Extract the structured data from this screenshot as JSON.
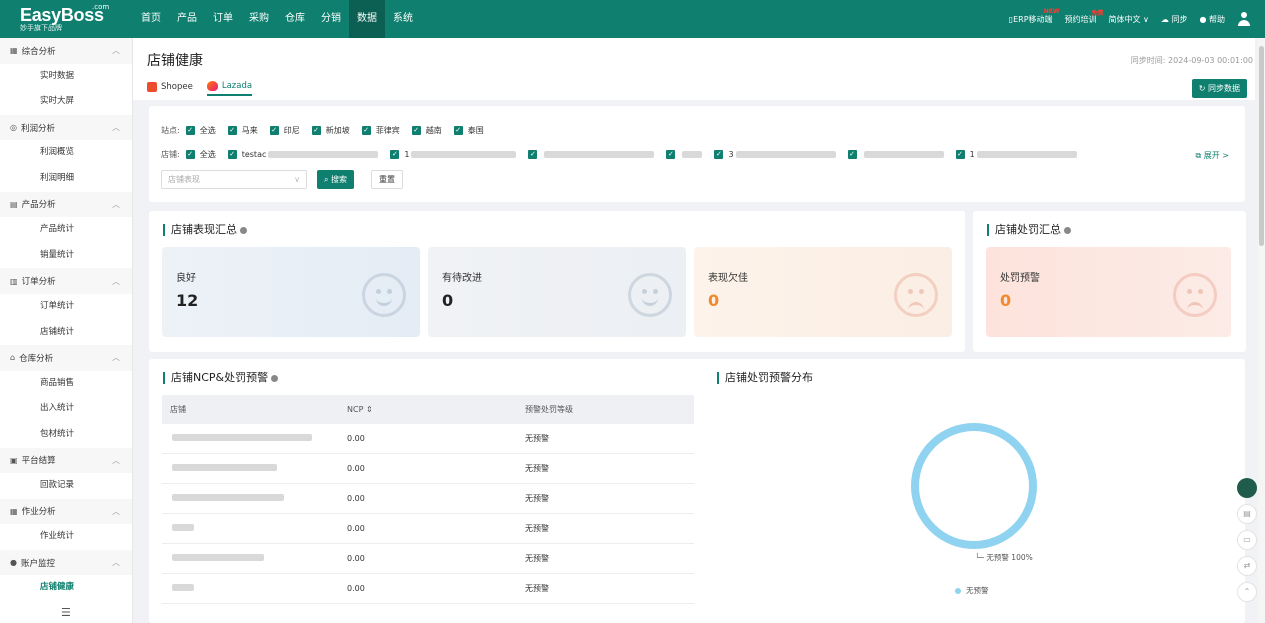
{
  "brand": {
    "name": "EasyBoss",
    "com": ".com",
    "tagline": "妙手旗下品牌"
  },
  "nav": [
    "首页",
    "产品",
    "订单",
    "采购",
    "仓库",
    "分销",
    "数据",
    "系统"
  ],
  "nav_active": "数据",
  "top_right": {
    "erp": "ERP移动端",
    "erp_badge": "NEW",
    "training": "预约培训",
    "training_badge": "免费",
    "lang": "简体中文 ∨",
    "sync": "同步",
    "help": "帮助"
  },
  "sidebar": [
    {
      "group": "综合分析",
      "items": [
        "实时数据",
        "实时大屏"
      ]
    },
    {
      "group": "利润分析",
      "items": [
        "利润概览",
        "利润明细"
      ]
    },
    {
      "group": "产品分析",
      "items": [
        "产品统计",
        "销量统计"
      ]
    },
    {
      "group": "订单分析",
      "items": [
        "订单统计",
        "店铺统计"
      ]
    },
    {
      "group": "仓库分析",
      "items": [
        "商品销售",
        "出入统计",
        "包材统计"
      ]
    },
    {
      "group": "平台结算",
      "items": [
        "回款记录"
      ]
    },
    {
      "group": "作业分析",
      "items": [
        "作业统计"
      ]
    },
    {
      "group": "账户监控",
      "items": [
        "店铺健康"
      ]
    }
  ],
  "sidebar_active": "店铺健康",
  "page": {
    "title": "店铺健康",
    "sync_time": "同步时间: 2024-09-03 00:01:00",
    "sync_button": "同步数据"
  },
  "platforms": [
    {
      "name": "Shopee",
      "active": false
    },
    {
      "name": "Lazada",
      "active": true
    }
  ],
  "filter": {
    "site_label": "站点:",
    "sites": [
      "全选",
      "马来",
      "印尼",
      "新加坡",
      "菲律宾",
      "越南",
      "泰国"
    ],
    "shop_label": "店铺:",
    "shop_all": "全选",
    "shop_partial": [
      "testac",
      "1",
      "",
      "",
      "",
      "3",
      "1"
    ],
    "expand": "展开 >",
    "select_placeholder": "店铺表现",
    "search": "搜索",
    "reset": "重置"
  },
  "performance": {
    "title": "店铺表现汇总",
    "stats": [
      {
        "label": "良好",
        "value": "12"
      },
      {
        "label": "有待改进",
        "value": "0"
      },
      {
        "label": "表现欠佳",
        "value": "0"
      }
    ]
  },
  "penalty": {
    "title": "店铺处罚汇总",
    "label": "处罚预警",
    "value": "0"
  },
  "ncp": {
    "title": "店铺NCP&处罚预警",
    "headers": [
      "店铺",
      "NCP ⇕",
      "预警处罚等级"
    ],
    "rows": [
      {
        "ncp": "0.00",
        "level": "无预警"
      },
      {
        "ncp": "0.00",
        "level": "无预警"
      },
      {
        "ncp": "0.00",
        "level": "无预警"
      },
      {
        "ncp": "0.00",
        "level": "无预警"
      },
      {
        "ncp": "0.00",
        "level": "无预警"
      },
      {
        "ncp": "0.00",
        "level": "无预警"
      }
    ]
  },
  "distribution": {
    "title": "店铺处罚预警分布",
    "slice_label": "无预警 100%",
    "legend": "无预警",
    "color": "#8fd3f0"
  },
  "colors": {
    "primary": "#0f7f6f"
  }
}
